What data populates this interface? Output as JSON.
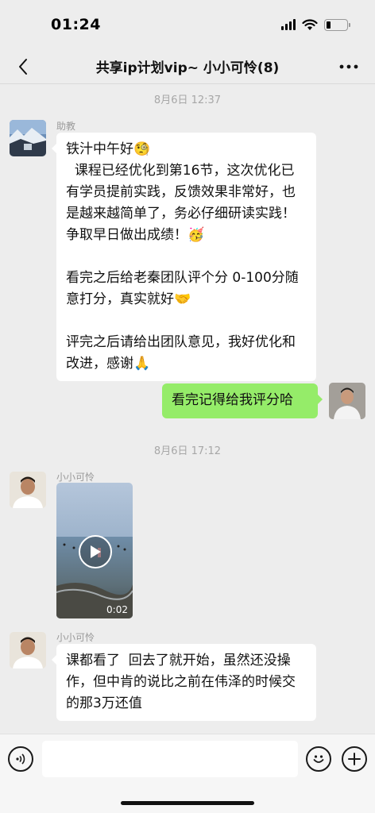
{
  "status_bar": {
    "time": "01:24",
    "icons": [
      "cellular-signal-icon",
      "wifi-icon",
      "battery-icon"
    ],
    "battery_level": 0.2
  },
  "nav": {
    "title": "共享ip计划vip~ 小小可怜(8)",
    "back_icon": "chevron-left-icon",
    "more_icon": "ellipsis-icon"
  },
  "messages": {
    "ts1": "8月6日 12:37",
    "m1": {
      "sender": "助教",
      "lines": [
        "铁汁中午好🧐",
        "  课程已经优化到第16节，这次优化已有学员提前实践，反馈效果非常好，也是越来越简单了，务必仔细研读实践！争取早日做出成绩！🥳",
        "看完之后给老秦团队评个分 0-100分随意打分，真实就好🤝",
        "评完之后请给出团队意见，我好优化和改进，感谢🙏"
      ]
    },
    "m2": {
      "text": "看完记得给我评分哈"
    },
    "ts2": "8月6日 17:12",
    "m3": {
      "sender": "小小可怜",
      "video_duration": "0:02"
    },
    "m4": {
      "sender": "小小可怜",
      "text": "课都看了  回去了就开始，虽然还没操作，但中肯的说比之前在伟泽的时候交的那3万还值"
    }
  },
  "input_bar": {
    "icons": [
      "voice-icon",
      "emoji-icon",
      "plus-icon"
    ]
  },
  "colors": {
    "background": "#EDEDED",
    "bubble_mine": "#95EC69",
    "bubble_other": "#FFFFFF"
  }
}
